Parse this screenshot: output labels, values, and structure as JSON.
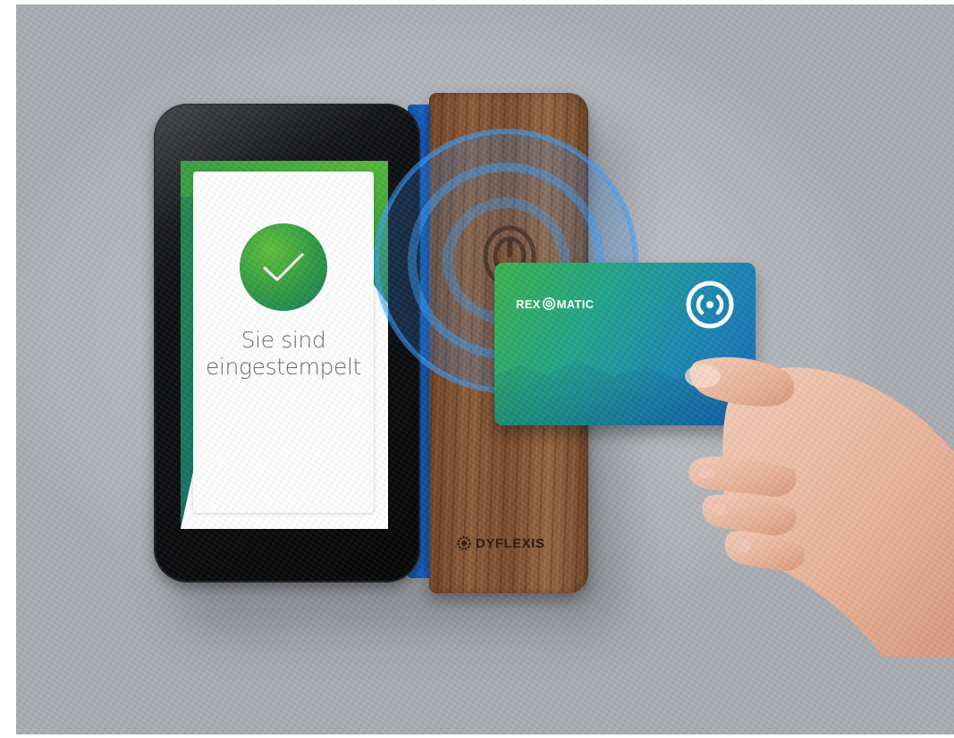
{
  "terminal": {
    "screen": {
      "status_line_1": "Sie sind",
      "status_line_2": "eingestempelt",
      "icon": "checkmark-icon"
    },
    "reader_brand": "DYFLEXIS",
    "reader_logo_icon": "gear-d-icon"
  },
  "card": {
    "brand_prefix": "REX",
    "brand_suffix": "MATIC",
    "logo_icon": "nfc-signal-icon"
  },
  "colors": {
    "accent_green": "#2e9944",
    "accent_blue": "#1766bf",
    "nfc_wave_blue": "#3aa0ff"
  }
}
